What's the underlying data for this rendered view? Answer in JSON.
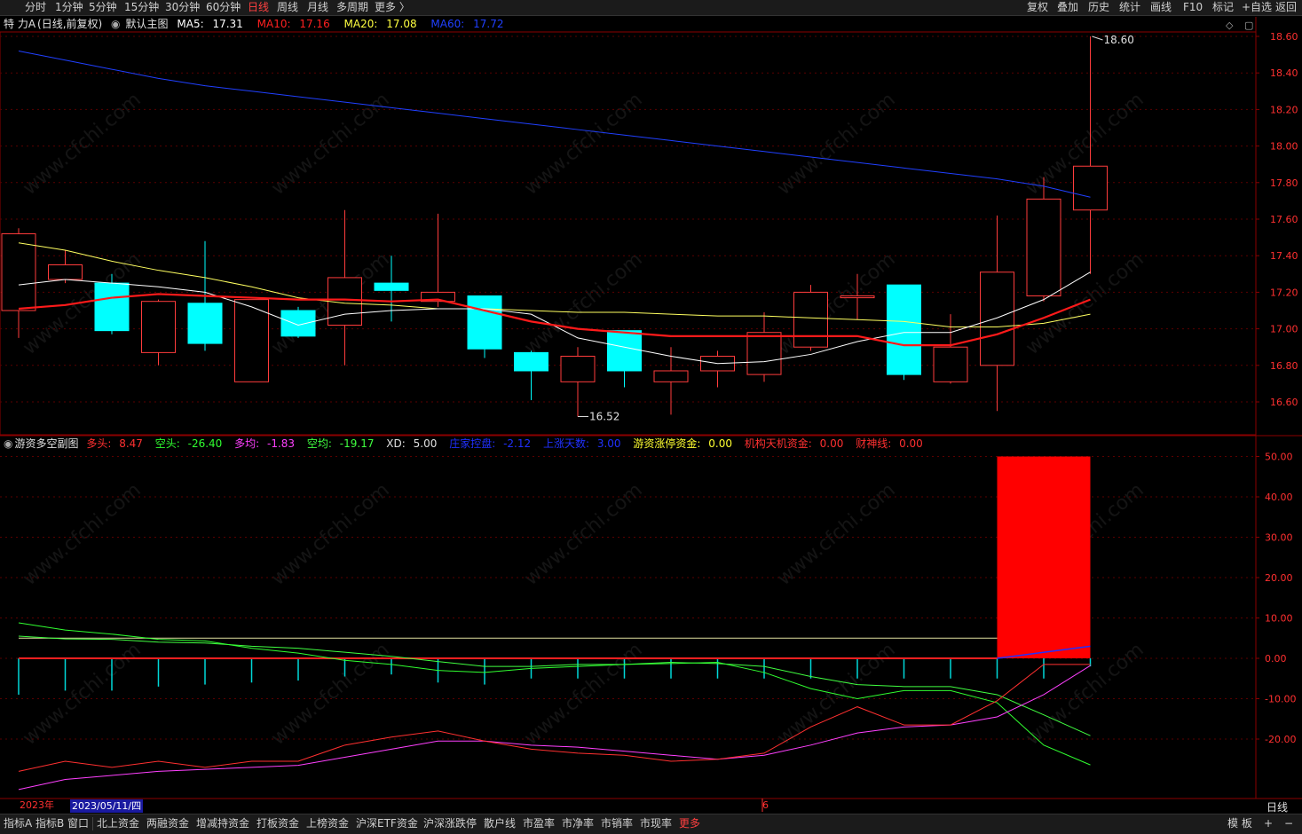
{
  "toolbar": {
    "periods": [
      "分时",
      "1分钟",
      "5分钟",
      "15分钟",
      "30分钟",
      "60分钟",
      "日线",
      "周线",
      "月线",
      "多周期",
      "更多 〉"
    ],
    "active_period": "日线",
    "right_buttons": [
      "复权",
      "叠加",
      "历史",
      "统计",
      "画线",
      "F10",
      "标记",
      "+自选",
      "返回"
    ]
  },
  "main_chart": {
    "stock_name": "特 力A",
    "period_mode": "(日线,前复权)",
    "indicator_label": "默认主图",
    "ma": [
      {
        "label": "MA5:",
        "value": "17.31",
        "color": "#ffffff"
      },
      {
        "label": "MA10:",
        "value": "17.16",
        "color": "#ff2020"
      },
      {
        "label": "MA20:",
        "value": "17.08",
        "color": "#ffff40"
      },
      {
        "label": "MA60:",
        "value": "17.72",
        "color": "#2040ff"
      }
    ],
    "high_label": "18.60",
    "low_label": "16.52",
    "y_ticks": [
      "18.60",
      "18.40",
      "18.20",
      "18.00",
      "17.80",
      "17.60",
      "17.40",
      "17.20",
      "17.00",
      "16.80",
      "16.60"
    ]
  },
  "sub_chart": {
    "name": "游资多空副图",
    "indicators": [
      {
        "label": "多头:",
        "value": "8.47",
        "color": "#ff3030"
      },
      {
        "label": "空头:",
        "value": "-26.40",
        "color": "#30ff30"
      },
      {
        "label": "多均:",
        "value": "-1.83",
        "color": "#ff40ff"
      },
      {
        "label": "空均:",
        "value": "-19.17",
        "color": "#40ff40"
      },
      {
        "label": "XD:",
        "value": "5.00",
        "color": "#e0e0e0"
      },
      {
        "label": "庄家控盘:",
        "value": "-2.12",
        "color": "#2030ff"
      },
      {
        "label": "上涨天数:",
        "value": "3.00",
        "color": "#2030ff"
      },
      {
        "label": "游资涨停资金:",
        "value": "0.00",
        "color": "#ffff30"
      },
      {
        "label": "机构天机资金:",
        "value": "0.00",
        "color": "#ff3030"
      },
      {
        "label": "财神线:",
        "value": "0.00",
        "color": "#ff3030"
      }
    ],
    "y_ticks": [
      "50.00",
      "40.00",
      "30.00",
      "20.00",
      "10.00",
      "0.00",
      "-10.00",
      "-20.00"
    ]
  },
  "date_axis": {
    "year": "2023年",
    "cursor_date": "2023/05/11/四",
    "month_mark": "6"
  },
  "period_label": "日线",
  "bottom_tabs": [
    "指标A",
    "指标B",
    "窗口",
    "北上资金",
    "两融资金",
    "增减持资金",
    "打板资金",
    "上榜资金",
    "沪深ETF资金",
    "沪深涨跌停",
    "散户线",
    "市盈率",
    "市净率",
    "市销率",
    "市现率",
    "更多"
  ],
  "bottom_right": [
    "模 板",
    "+",
    "−"
  ],
  "watermark": "www.cfchi.com",
  "candles": [
    {
      "o": 17.1,
      "h": 17.55,
      "l": 16.95,
      "c": 17.52
    },
    {
      "o": 17.27,
      "h": 17.43,
      "l": 17.25,
      "c": 17.35
    },
    {
      "o": 17.25,
      "h": 17.3,
      "l": 16.97,
      "c": 16.99
    },
    {
      "o": 16.87,
      "h": 17.16,
      "l": 16.8,
      "c": 17.15
    },
    {
      "o": 17.14,
      "h": 17.48,
      "l": 16.88,
      "c": 16.92
    },
    {
      "o": 16.71,
      "h": 17.16,
      "l": 16.71,
      "c": 17.16
    },
    {
      "o": 17.1,
      "h": 17.12,
      "l": 16.95,
      "c": 16.96
    },
    {
      "o": 17.02,
      "h": 17.65,
      "l": 16.8,
      "c": 17.28
    },
    {
      "o": 17.25,
      "h": 17.4,
      "l": 17.04,
      "c": 17.21
    },
    {
      "o": 17.15,
      "h": 17.63,
      "l": 17.12,
      "c": 17.2
    },
    {
      "o": 17.18,
      "h": 17.18,
      "l": 16.84,
      "c": 16.89
    },
    {
      "o": 16.87,
      "h": 16.88,
      "l": 16.61,
      "c": 16.77
    },
    {
      "o": 16.71,
      "h": 16.9,
      "l": 16.52,
      "c": 16.85
    },
    {
      "o": 16.99,
      "h": 16.99,
      "l": 16.68,
      "c": 16.77
    },
    {
      "o": 16.71,
      "h": 16.9,
      "l": 16.53,
      "c": 16.77
    },
    {
      "o": 16.77,
      "h": 16.88,
      "l": 16.68,
      "c": 16.85
    },
    {
      "o": 16.75,
      "h": 17.09,
      "l": 16.71,
      "c": 16.98
    },
    {
      "o": 16.9,
      "h": 17.24,
      "l": 16.88,
      "c": 17.2
    },
    {
      "o": 17.17,
      "h": 17.3,
      "l": 17.05,
      "c": 17.18
    },
    {
      "o": 17.24,
      "h": 17.24,
      "l": 16.72,
      "c": 16.75
    },
    {
      "o": 16.71,
      "h": 17.08,
      "l": 16.7,
      "c": 16.9
    },
    {
      "o": 16.8,
      "h": 17.62,
      "l": 16.55,
      "c": 17.31
    },
    {
      "o": 17.18,
      "h": 17.83,
      "l": 17.15,
      "c": 17.71
    },
    {
      "o": 17.65,
      "h": 18.6,
      "l": 17.3,
      "c": 17.89
    }
  ],
  "ma5": [
    17.24,
    17.27,
    17.25,
    17.23,
    17.2,
    17.12,
    17.02,
    17.08,
    17.1,
    17.11,
    17.11,
    17.08,
    16.95,
    16.9,
    16.85,
    16.81,
    16.82,
    16.86,
    16.93,
    16.98,
    16.98,
    17.06,
    17.16,
    17.31
  ],
  "ma10": [
    17.11,
    17.13,
    17.17,
    17.19,
    17.18,
    17.17,
    17.16,
    17.16,
    17.15,
    17.16,
    17.1,
    17.04,
    17.0,
    16.98,
    16.96,
    16.96,
    16.96,
    16.96,
    16.96,
    16.91,
    16.91,
    16.97,
    17.06,
    17.16
  ],
  "ma20": [
    17.47,
    17.43,
    17.37,
    17.32,
    17.28,
    17.23,
    17.17,
    17.14,
    17.13,
    17.11,
    17.11,
    17.1,
    17.09,
    17.09,
    17.08,
    17.07,
    17.07,
    17.06,
    17.05,
    17.04,
    17.01,
    17.01,
    17.03,
    17.08
  ],
  "ma60": [
    18.52,
    18.47,
    18.42,
    18.37,
    18.33,
    18.3,
    18.27,
    18.24,
    18.21,
    18.18,
    18.15,
    18.12,
    18.09,
    18.06,
    18.03,
    18.0,
    17.97,
    17.94,
    17.91,
    17.88,
    17.85,
    17.82,
    17.78,
    17.72
  ],
  "sub_series": {
    "duotou": [
      -28.0,
      -25.5,
      -27.0,
      -25.5,
      -27.0,
      -25.5,
      -25.5,
      -21.5,
      -19.5,
      -18.0,
      -20.5,
      -22.5,
      -23.5,
      -24.0,
      -25.5,
      -25.0,
      -23.5,
      -17.0,
      -12.0,
      -16.5,
      -16.5,
      -10.5,
      -1.5,
      -1.5
    ],
    "kongtou": [
      8.8,
      7.0,
      6.0,
      4.7,
      4.3,
      2.5,
      1.3,
      -0.5,
      -1.5,
      -3.0,
      -3.5,
      -2.5,
      -2.0,
      -1.5,
      -1.3,
      -1.0,
      -3.5,
      -7.5,
      -10.0,
      -8.0,
      -8.0,
      -11.0,
      -21.5,
      -26.4
    ],
    "duojun": [
      -32.5,
      -30.0,
      -29.0,
      -28.0,
      -27.5,
      -27.0,
      -26.5,
      -24.5,
      -22.5,
      -20.5,
      -20.5,
      -21.5,
      -22.0,
      -23.0,
      -24.0,
      -25.0,
      -24.0,
      -21.5,
      -18.5,
      -17.0,
      -16.5,
      -14.5,
      -9.0,
      -1.8
    ],
    "kongjun": [
      5.5,
      4.8,
      4.7,
      4.0,
      3.8,
      3.0,
      2.5,
      1.5,
      0.5,
      -0.8,
      -2.0,
      -2.0,
      -1.5,
      -1.5,
      -1.0,
      -1.3,
      -2.0,
      -4.5,
      -6.5,
      -7.0,
      -7.0,
      -9.0,
      -14.0,
      -19.17
    ],
    "hist": [
      -9.0,
      -8.0,
      -8.0,
      -7.0,
      -6.5,
      -6.0,
      -5.5,
      -4.5,
      -4.0,
      -6.0,
      -6.5,
      -5.0,
      -5.0,
      -5.0,
      -5.0,
      -5.0,
      -5.0,
      -5.0,
      -5.0,
      -5.0,
      -5.0,
      -5.0,
      -5.0,
      -2.0
    ],
    "red_block_value": 50.0
  }
}
